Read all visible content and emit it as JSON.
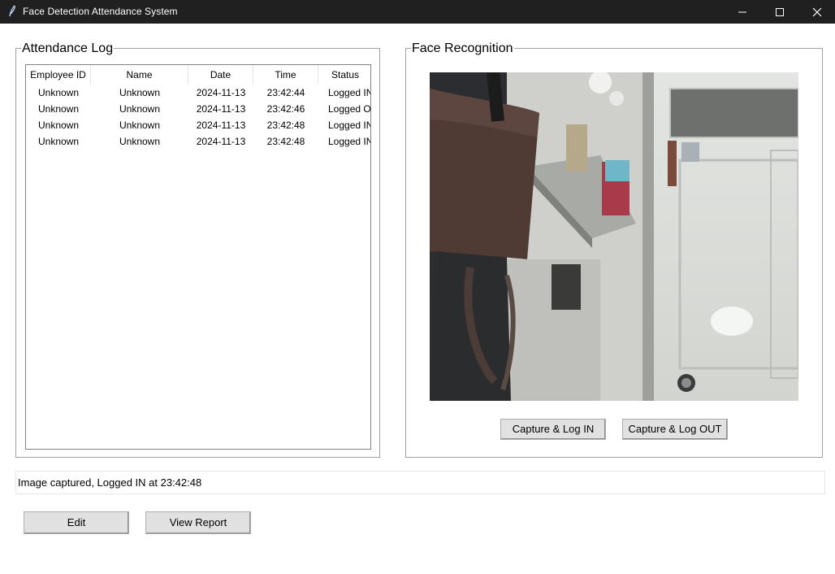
{
  "window": {
    "title": "Face Detection Attendance System",
    "icons": {
      "app": "feather-icon",
      "minimize": "minimize-icon",
      "maximize": "maximize-icon",
      "close": "close-icon"
    }
  },
  "attendance_log": {
    "label": "Attendance Log",
    "columns": [
      "Employee ID",
      "Name",
      "Date",
      "Time",
      "Status"
    ],
    "rows": [
      {
        "employee_id": "Unknown",
        "name": "Unknown",
        "date": "2024-11-13",
        "time": "23:42:44",
        "status": "Logged IN"
      },
      {
        "employee_id": "Unknown",
        "name": "Unknown",
        "date": "2024-11-13",
        "time": "23:42:46",
        "status": "Logged OUT"
      },
      {
        "employee_id": "Unknown",
        "name": "Unknown",
        "date": "2024-11-13",
        "time": "23:42:48",
        "status": "Logged IN"
      },
      {
        "employee_id": "Unknown",
        "name": "Unknown",
        "date": "2024-11-13",
        "time": "23:42:48",
        "status": "Logged IN"
      }
    ]
  },
  "face_recognition": {
    "label": "Face Recognition",
    "capture_in_label": "Capture & Log IN",
    "capture_out_label": "Capture & Log OUT"
  },
  "status_message": "Image captured, Logged IN at 23:42:48",
  "actions": {
    "edit_label": "Edit",
    "report_label": "View Report"
  }
}
